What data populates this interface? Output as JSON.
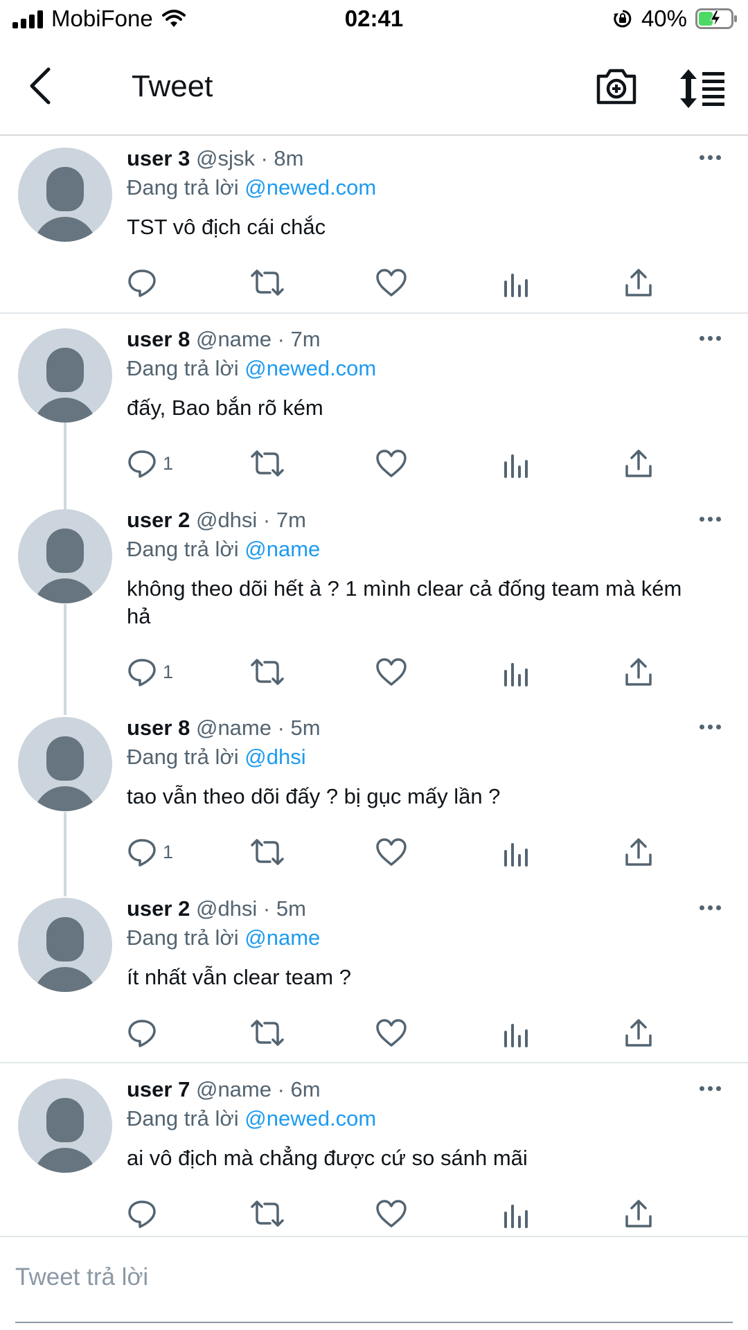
{
  "status_bar": {
    "carrier": "MobiFone",
    "time": "02:41",
    "battery": "40%"
  },
  "header": {
    "title": "Tweet"
  },
  "tweets": [
    {
      "name": "user 3",
      "meta": "@sjsk · 8m",
      "reply_prefix": "Đang trả lời",
      "mention": "@newed.com",
      "text": "TST vô địch cái chắc",
      "reply_count": ""
    },
    {
      "name": "user 8",
      "meta": "@name · 7m",
      "reply_prefix": "Đang trả lời",
      "mention": "@newed.com",
      "text": "đấy, Bao bắn rõ kém",
      "reply_count": "1"
    },
    {
      "name": "user 2",
      "meta": " @dhsi · 7m",
      "reply_prefix": "Đang trả lời",
      "mention": "@name",
      "text": "không theo dõi hết à ? 1 mình clear cả đống team mà kém hả",
      "reply_count": "1"
    },
    {
      "name": "user 8",
      "meta": "@name · 5m",
      "reply_prefix": "Đang trả lời",
      "mention": "@dhsi",
      "text": "tao vẫn theo dõi đấy ? bị gục mấy lần ?",
      "reply_count": "1"
    },
    {
      "name": "user 2",
      "meta": " @dhsi · 5m",
      "reply_prefix": "Đang trả lời",
      "mention": "@name",
      "text": "ít nhất vẫn clear team ?",
      "reply_count": ""
    },
    {
      "name": "user 7",
      "meta": "@name · 6m",
      "reply_prefix": "Đang trả lời",
      "mention": "@newed.com",
      "text": "ai vô địch mà chẳng được cứ so sánh mãi",
      "reply_count": ""
    }
  ],
  "composer": {
    "placeholder": "Tweet trả lời"
  },
  "icons": {
    "back": "chevron-left-icon",
    "camera": "camera-plus-icon",
    "sort": "sort-list-icon",
    "reply": "comment-bubble-icon",
    "retweet": "retweet-icon",
    "like": "heart-icon",
    "stats": "bar-chart-icon",
    "share": "share-upload-icon"
  },
  "colors": {
    "accent": "#1d9bf0",
    "secondary_text": "#536471",
    "avatar_bg": "#ccd5dd"
  }
}
